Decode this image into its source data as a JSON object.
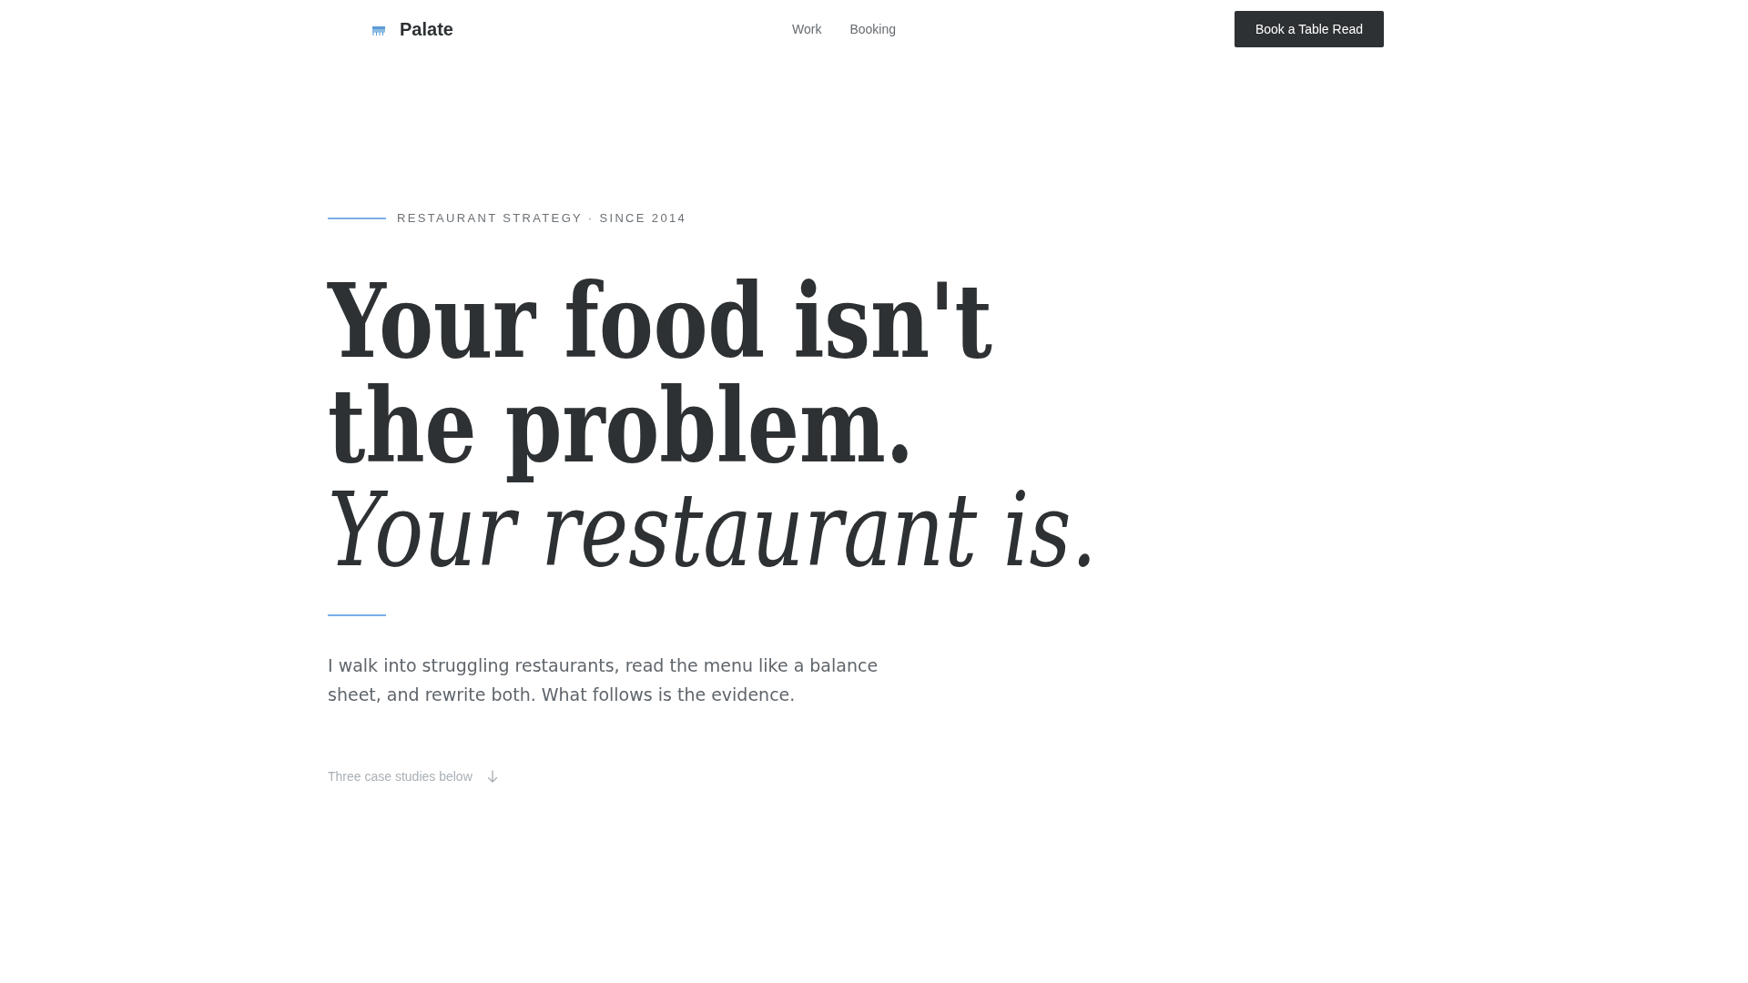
{
  "header": {
    "brand": {
      "name": "Palate"
    },
    "nav": [
      {
        "label": "Work"
      },
      {
        "label": "Booking"
      }
    ],
    "cta": "Book a Table Read"
  },
  "hero": {
    "eyebrow": "RESTAURANT STRATEGY · SINCE 2014",
    "headline": [
      {
        "text": "Your food isn't",
        "kind": "bold"
      },
      {
        "text": "the problem.",
        "kind": "bold"
      },
      {
        "text": "Your restaurant is.",
        "kind": "italic"
      }
    ],
    "lede": "I walk into struggling restaurants, read the menu like a balance sheet, and rewrite both. What follows is the evidence.",
    "scroll_cue": "Three case studies below"
  }
}
